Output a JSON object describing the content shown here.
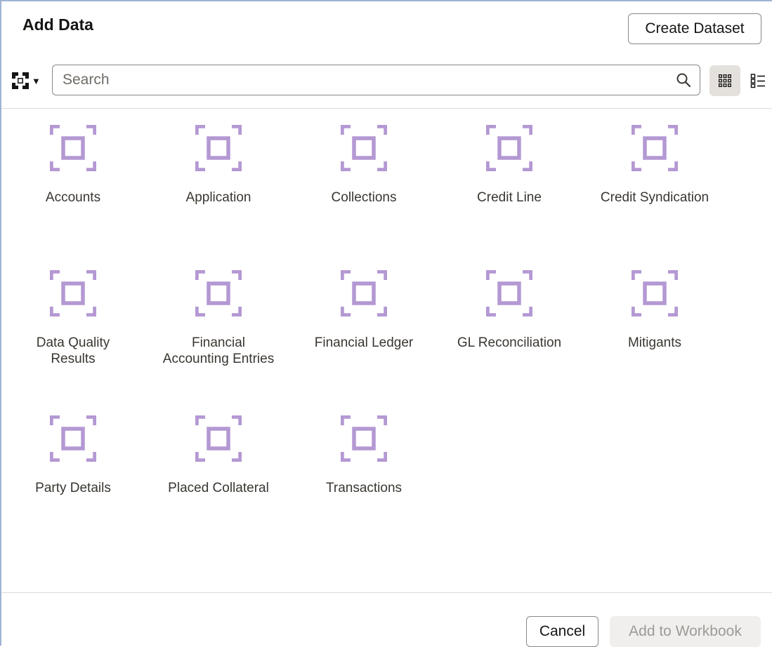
{
  "dialog": {
    "title": "Add Data",
    "create_dataset_label": "Create Dataset",
    "cancel_label": "Cancel",
    "add_to_workbook_label": "Add to Workbook"
  },
  "toolbar": {
    "source_picker_icon": "dataset-filter-icon",
    "search_placeholder": "Search",
    "search_value": "",
    "view_modes": [
      "grid-view-icon",
      "list-view-icon"
    ],
    "active_view": "grid"
  },
  "datasets": [
    {
      "label": "Accounts",
      "icon": "subject-area-icon"
    },
    {
      "label": "Application",
      "icon": "subject-area-icon"
    },
    {
      "label": "Collections",
      "icon": "subject-area-icon"
    },
    {
      "label": "Credit Line",
      "icon": "subject-area-icon"
    },
    {
      "label": "Credit Syndication",
      "icon": "subject-area-icon"
    },
    {
      "label": "Data Quality Results",
      "icon": "subject-area-icon"
    },
    {
      "label": "Financial Accounting Entries",
      "icon": "subject-area-icon"
    },
    {
      "label": "Financial Ledger",
      "icon": "subject-area-icon"
    },
    {
      "label": "GL Reconciliation",
      "icon": "subject-area-icon"
    },
    {
      "label": "Mitigants",
      "icon": "subject-area-icon"
    },
    {
      "label": "Party Details",
      "icon": "subject-area-icon"
    },
    {
      "label": "Placed Collateral",
      "icon": "subject-area-icon"
    },
    {
      "label": "Transactions",
      "icon": "subject-area-icon"
    }
  ],
  "colors": {
    "icon_purple": "#b498d3",
    "disabled_button_bg": "#f1efed",
    "disabled_button_text": "#9e9a96"
  }
}
